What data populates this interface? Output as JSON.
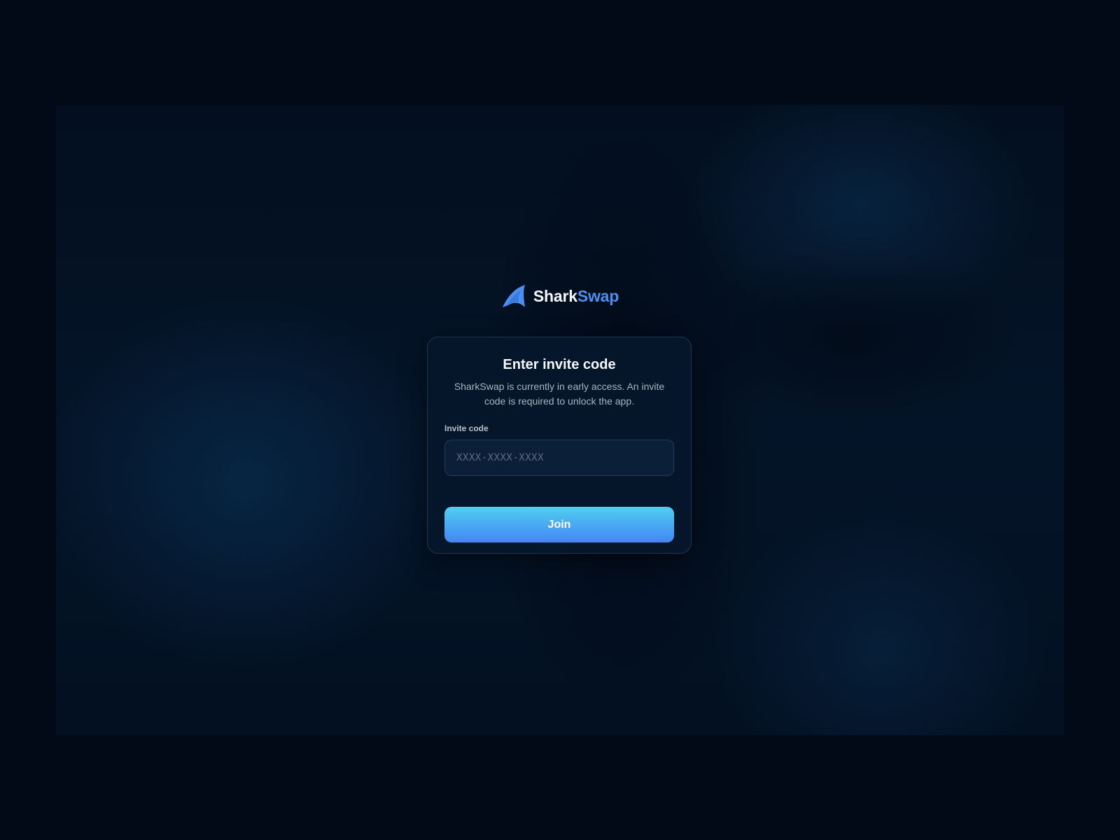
{
  "brand": {
    "name_part_a": "Shark",
    "name_part_b": "Swap",
    "icon": "shark-fin-icon",
    "accent_color": "#4d8ff0"
  },
  "invite_card": {
    "title": "Enter invite code",
    "subtitle": "SharkSwap is currently in early access. An invite code is required to unlock the app.",
    "field": {
      "label": "Invite code",
      "value": "",
      "placeholder": "XXXX-XXXX-XXXX"
    },
    "submit_label": "Join"
  },
  "colors": {
    "page_background": "#020a18",
    "card_background": "#05162a",
    "button_gradient_top": "#4fd0ee",
    "button_gradient_bottom": "#4386f3"
  }
}
